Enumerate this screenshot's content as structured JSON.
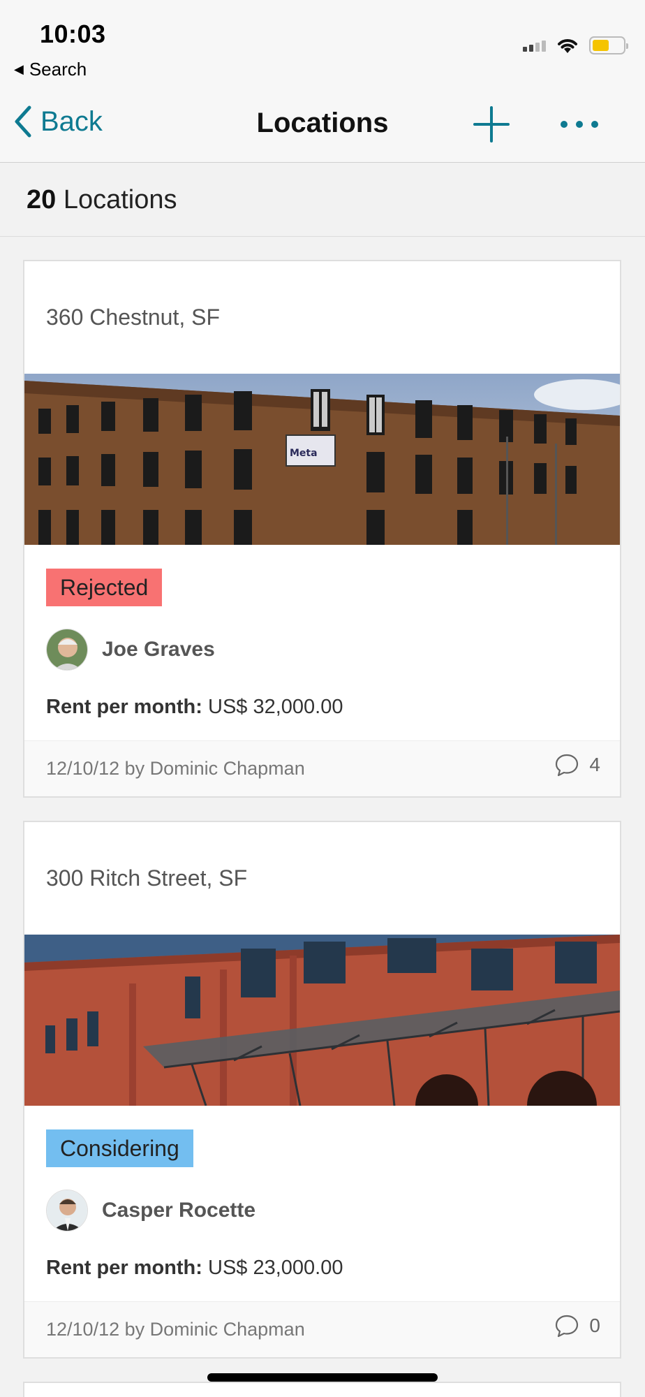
{
  "status_bar": {
    "time": "10:03",
    "back_label": "Search"
  },
  "nav": {
    "back_label": "Back",
    "title": "Locations"
  },
  "header": {
    "count": "20",
    "count_label": "Locations"
  },
  "colors": {
    "accent": "#0e7a91",
    "rejected": "#f87272",
    "considering": "#73bef0"
  },
  "locations": [
    {
      "title": "360 Chestnut, SF",
      "status": "Rejected",
      "owner": "Joe Graves",
      "rent_label": "Rent per month:",
      "rent_value": "US$ 32,000.00",
      "meta": "12/10/12 by Dominic Chapman",
      "comments": "4",
      "sign_text": "Meta"
    },
    {
      "title": "300 Ritch Street, SF",
      "status": "Considering",
      "owner": "Casper Rocette",
      "rent_label": "Rent per month:",
      "rent_value": "US$ 23,000.00",
      "meta": "12/10/12 by Dominic Chapman",
      "comments": "0"
    }
  ]
}
